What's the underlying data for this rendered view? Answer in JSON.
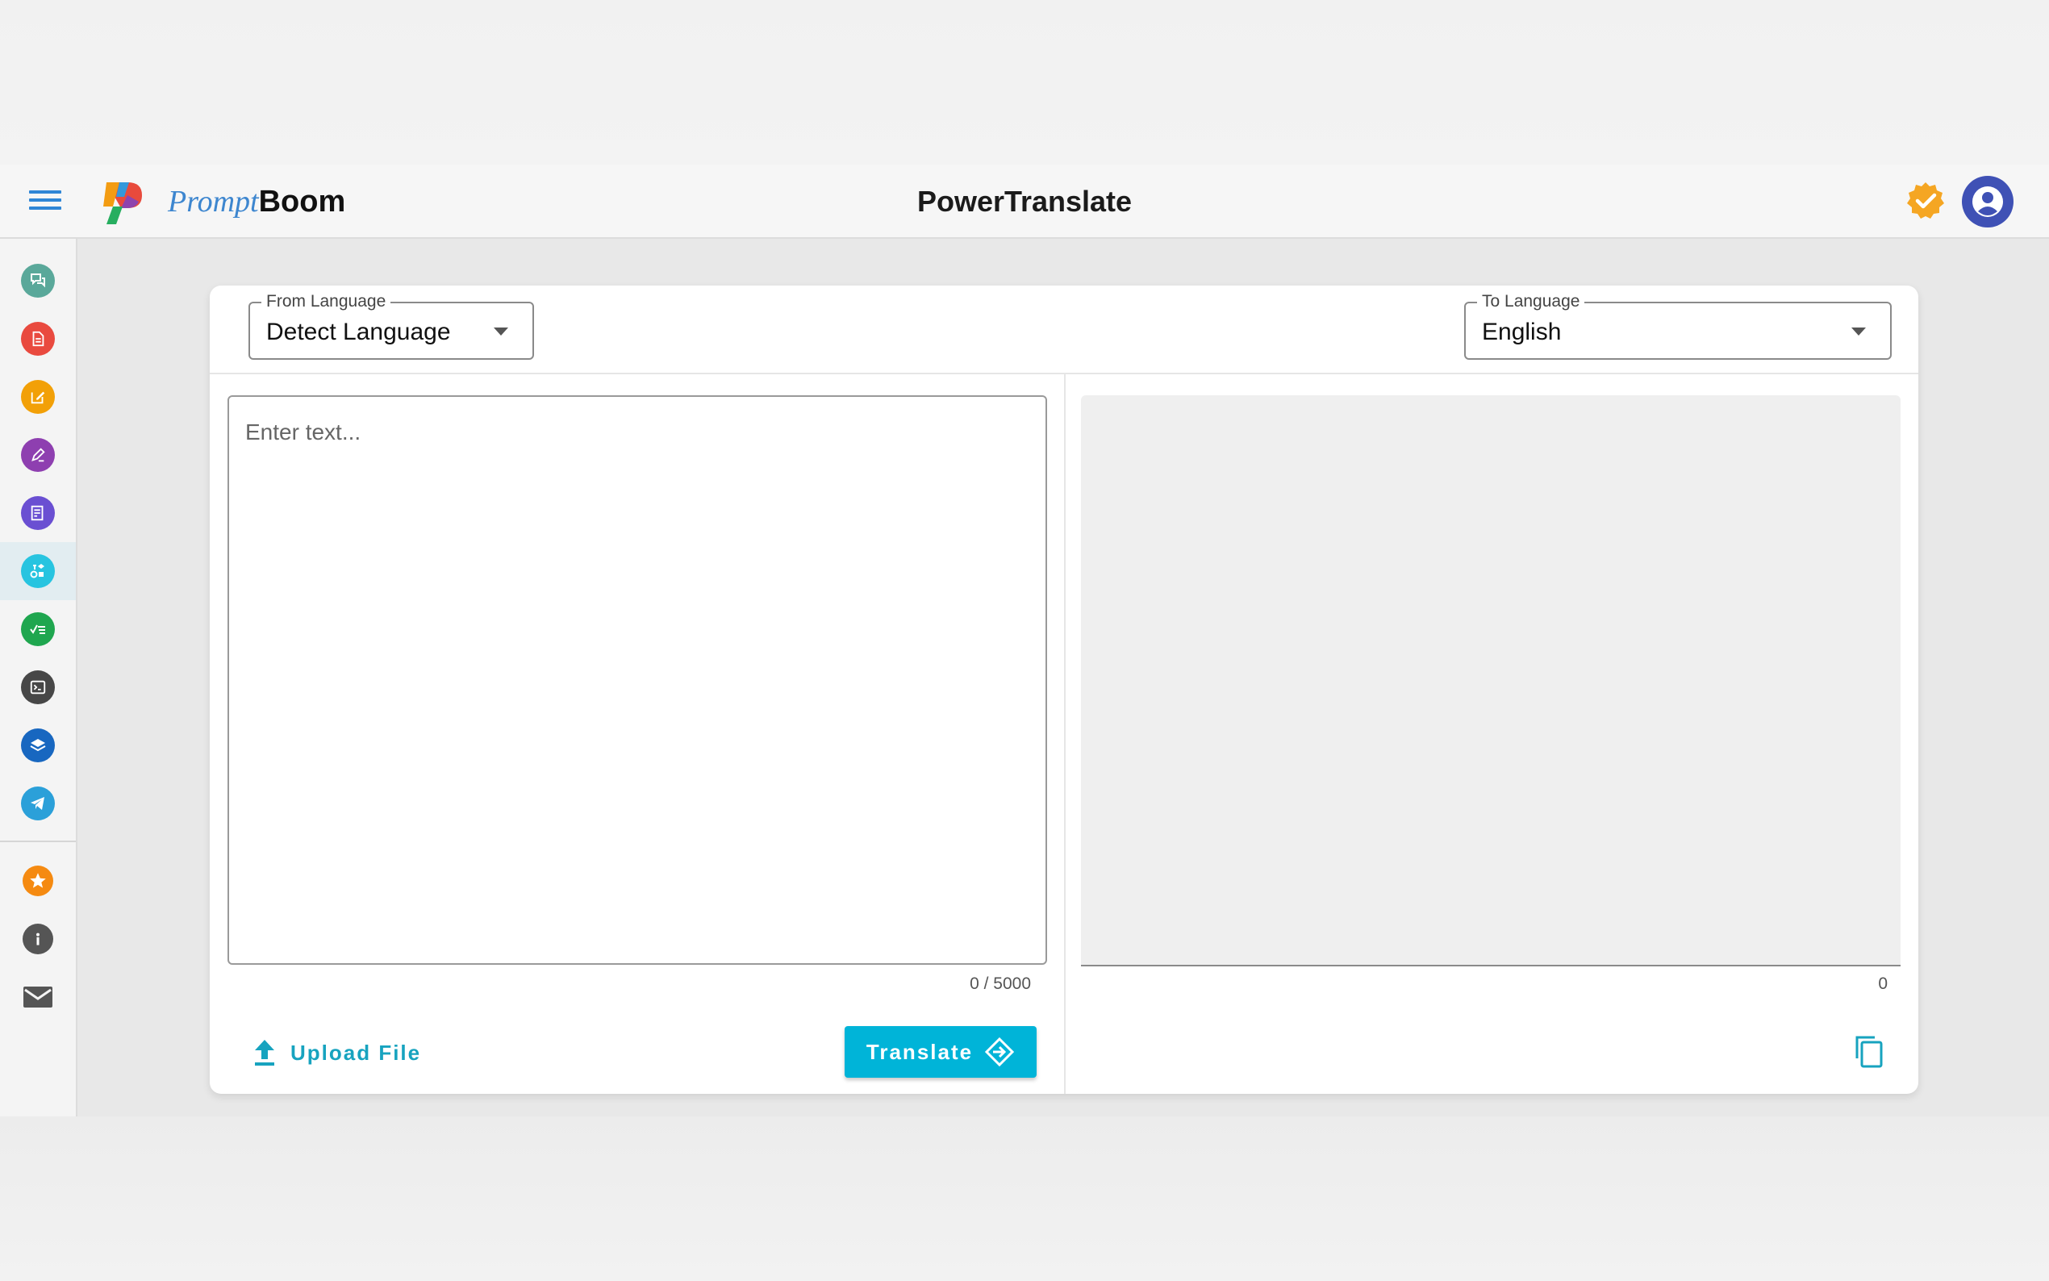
{
  "app": {
    "brand_part1": "Prompt",
    "brand_part2": "Boom",
    "title": "PowerTranslate"
  },
  "header": {
    "menu_icon": "hamburger-menu-icon",
    "verified_icon": "verified-badge-icon",
    "account_icon": "account-circle-icon"
  },
  "sidebar": {
    "items": [
      {
        "icon": "chat-bubbles-icon",
        "color": "#5aa89a"
      },
      {
        "icon": "document-icon",
        "color": "#e94a3f"
      },
      {
        "icon": "edit-square-icon",
        "color": "#f2a007"
      },
      {
        "icon": "pen-icon",
        "color": "#8e3fb0"
      },
      {
        "icon": "notes-edit-icon",
        "color": "#6a4fd2"
      },
      {
        "icon": "translate-shapes-icon",
        "color": "#27c4e0",
        "active": true
      },
      {
        "icon": "checklist-icon",
        "color": "#1fa64f"
      },
      {
        "icon": "terminal-icon",
        "color": "#474747"
      },
      {
        "icon": "layers-icon",
        "color": "#1867c0"
      },
      {
        "icon": "telegram-icon",
        "color": "#2ba0d9"
      }
    ],
    "secondary": [
      {
        "icon": "star-icon",
        "color": "#f58a11"
      },
      {
        "icon": "info-icon",
        "color": "#555555"
      },
      {
        "icon": "mail-icon",
        "color": "#555555"
      }
    ]
  },
  "from_language": {
    "label": "From Language",
    "value": "Detect Language"
  },
  "to_language": {
    "label": "To Language",
    "value": "English"
  },
  "source": {
    "placeholder": "Enter text...",
    "counter": "0 / 5000"
  },
  "output": {
    "counter": "0"
  },
  "actions": {
    "upload_label": "Upload File",
    "translate_label": "Translate"
  },
  "colors": {
    "accent": "#00b4d8",
    "link": "#17a3bf",
    "avatar": "#3f51b5",
    "badge": "#f5a623"
  }
}
